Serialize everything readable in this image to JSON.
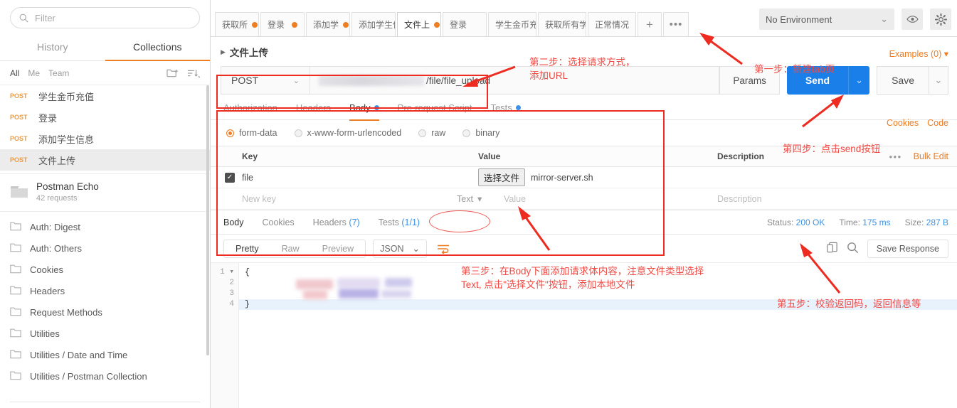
{
  "sidebar": {
    "filter_placeholder": "Filter",
    "tabs": [
      {
        "label": "History",
        "active": false
      },
      {
        "label": "Collections",
        "active": true
      }
    ],
    "scopes": [
      {
        "label": "All",
        "active": true
      },
      {
        "label": "Me",
        "active": false
      },
      {
        "label": "Team",
        "active": false
      }
    ],
    "new_folder_icon": "new-folder-icon",
    "sort_icon": "sort-icon",
    "requests": [
      {
        "method": "POST",
        "name": "学生金币充值",
        "selected": false
      },
      {
        "method": "POST",
        "name": "登录",
        "selected": false
      },
      {
        "method": "POST",
        "name": "添加学生信息",
        "selected": false
      },
      {
        "method": "POST",
        "name": "文件上传",
        "selected": true
      }
    ],
    "collection": {
      "title": "Postman Echo",
      "subtitle": "42 requests",
      "icon": "folder-icon"
    },
    "folders": [
      "Auth: Digest",
      "Auth: Others",
      "Cookies",
      "Headers",
      "Request Methods",
      "Utilities",
      "Utilities / Date and Time",
      "Utilities / Postman Collection"
    ]
  },
  "tabstrip": {
    "tabs": [
      {
        "label": "获取所",
        "dot": true,
        "active": false
      },
      {
        "label": "登录",
        "dot": true,
        "active": false
      },
      {
        "label": "添加学",
        "dot": true,
        "active": false
      },
      {
        "label": "添加学生信息",
        "dot": false,
        "active": false
      },
      {
        "label": "文件上",
        "dot": true,
        "active": true
      },
      {
        "label": "登录",
        "dot": false,
        "active": false
      },
      {
        "label": "学生金币充值",
        "dot": false,
        "active": false
      },
      {
        "label": "获取所有学生",
        "dot": false,
        "active": false
      },
      {
        "label": "正常情况",
        "dot": false,
        "active": false
      }
    ],
    "new_tab_label": "+",
    "more_label": "•••",
    "environment": "No Environment",
    "eye_icon": "eye-icon",
    "gear_icon": "gear-icon"
  },
  "request": {
    "breadcrumb": "文件上传",
    "examples_label": "Examples (0)",
    "method": "POST",
    "url_suffix": "/file/file_upload",
    "params_label": "Params",
    "send_label": "Send",
    "save_label": "Save",
    "tabs": [
      {
        "label": "Authorization",
        "active": false,
        "dot": false
      },
      {
        "label": "Headers",
        "active": false,
        "dot": false
      },
      {
        "label": "Body",
        "active": true,
        "dot": true
      },
      {
        "label": "Pre-request Script",
        "active": false,
        "dot": false
      },
      {
        "label": "Tests",
        "active": false,
        "dot": true
      }
    ],
    "cookies_label": "Cookies",
    "code_label": "Code",
    "body_types": [
      {
        "label": "form-data",
        "selected": true
      },
      {
        "label": "x-www-form-urlencoded",
        "selected": false
      },
      {
        "label": "raw",
        "selected": false
      },
      {
        "label": "binary",
        "selected": false
      }
    ],
    "table": {
      "headers": [
        "Key",
        "Value",
        "Description"
      ],
      "bulk_edit_label": "Bulk Edit",
      "more_label": "•••",
      "rows": [
        {
          "checked": true,
          "key": "file",
          "file_button": "选择文件",
          "file_name": "mirror-server.sh",
          "description": ""
        }
      ],
      "new_row": {
        "key_placeholder": "New key",
        "type_label": "Text",
        "value_placeholder": "Value",
        "description_placeholder": "Description"
      }
    }
  },
  "response": {
    "tabs": [
      {
        "label": "Body",
        "count": "",
        "active": true
      },
      {
        "label": "Cookies",
        "count": "",
        "active": false
      },
      {
        "label": "Headers",
        "count": "(7)",
        "active": false
      },
      {
        "label": "Tests",
        "count": "(1/1)",
        "active": false
      }
    ],
    "status_label": "Status:",
    "status_value": "200 OK",
    "time_label": "Time:",
    "time_value": "175 ms",
    "size_label": "Size:",
    "size_value": "287 B",
    "view_modes": [
      {
        "label": "Pretty",
        "active": true
      },
      {
        "label": "Raw",
        "active": false
      },
      {
        "label": "Preview",
        "active": false
      }
    ],
    "format": "JSON",
    "wrap_icon": "word-wrap-icon",
    "copy_icon": "copy-icon",
    "search_icon": "search-icon",
    "save_response_label": "Save Response",
    "line_numbers": [
      "1",
      "2",
      "3",
      "4"
    ],
    "code_lines": [
      "{",
      "",
      "",
      "}"
    ]
  },
  "annotations": [
    {
      "id": "step1",
      "text": "第一步：新建tab页"
    },
    {
      "id": "step2",
      "text": "第二步：选择请求方式，\n添加URL"
    },
    {
      "id": "step3",
      "text": "第三步：在Body下面添加请求体内容，注意文件类型选择\nText, 点击\"选择文件\"按钮，添加本地文件"
    },
    {
      "id": "step4",
      "text": "第四步：点击send按钮"
    },
    {
      "id": "step5",
      "text": "第五步：校验返回码，返回信息等"
    }
  ],
  "colors": {
    "accent_orange": "#ef7d22",
    "send_blue": "#1a7fe8",
    "annotation_red": "#ef4a44",
    "box_red": "#ee2b20",
    "link_blue": "#3c91e6"
  }
}
